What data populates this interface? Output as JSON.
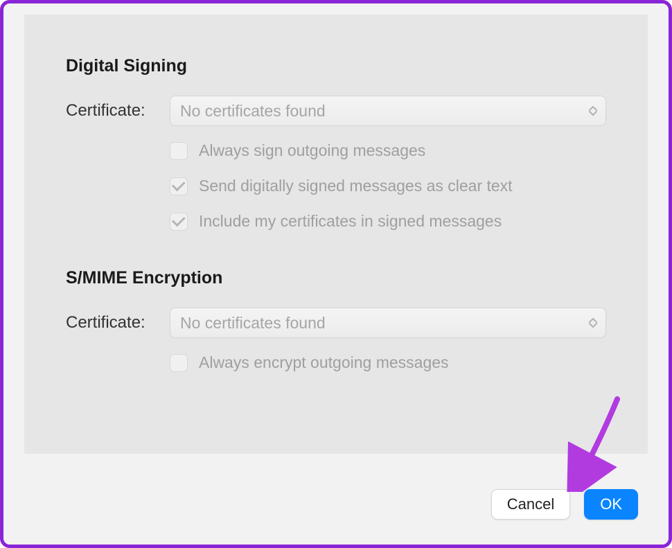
{
  "signing": {
    "title": "Digital Signing",
    "certificate_label": "Certificate:",
    "certificate_value": "No certificates found",
    "options": [
      {
        "label": "Always sign outgoing messages",
        "checked": false
      },
      {
        "label": "Send digitally signed messages as clear text",
        "checked": true
      },
      {
        "label": "Include my certificates in signed messages",
        "checked": true
      }
    ]
  },
  "encryption": {
    "title": "S/MIME Encryption",
    "certificate_label": "Certificate:",
    "certificate_value": "No certificates found",
    "options": [
      {
        "label": "Always encrypt outgoing messages",
        "checked": false
      }
    ]
  },
  "buttons": {
    "cancel": "Cancel",
    "ok": "OK"
  }
}
